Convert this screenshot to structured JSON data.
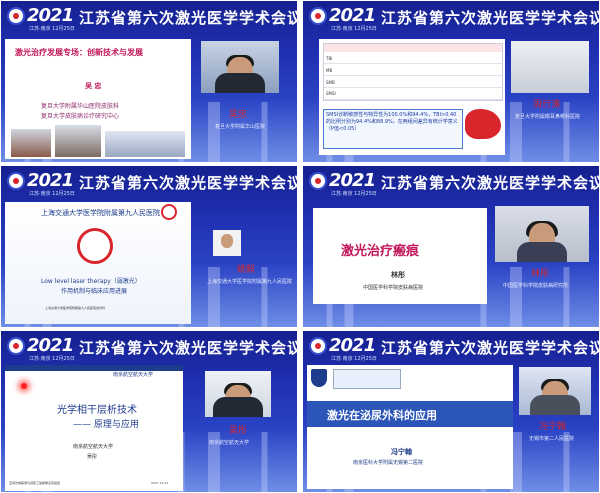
{
  "conference": {
    "year": "2021",
    "title": "江苏省第六次激光医学学术会议",
    "subtitle": "江苏·南京 12月25日"
  },
  "tiles": [
    {
      "slide_title": "激光治疗发展专场：创新技术与发展",
      "author": "吴 忠",
      "affiliations": [
        "复旦大学附属华山医院皮肤科",
        "复旦大学皮肤病诊疗研究中心"
      ],
      "speaker": "吴忠",
      "speaker_aff": "复旦大学附属华山医院"
    },
    {
      "table_rows": [
        "TBI",
        "MB",
        "SMB",
        "SMSI"
      ],
      "finding": "SMSI诊断敏感性与特异性为100.0%和94.4%，TBI>0.40的比例分别为94.4%和88.9%，在两组间差异有统计学意义（P值<0.05）",
      "speaker": "周行涛",
      "speaker_aff": "复旦大学附属眼耳鼻喉科医院"
    },
    {
      "slide_header": "上海交通大学医学院附属第九人民医院",
      "topic_en": "Low level laser therapy（弱激光）",
      "topic_cn": "作用机制与临床应用进展",
      "footer": "上海交通大学医学院附属第九人民医院激光科",
      "speaker": "姚毅",
      "speaker_aff": "上海交通大学医学院附属第九人民医院"
    },
    {
      "slide_title": "激光治疗瘢痕",
      "author": "林彤",
      "org": "中国医学科学院皮肤病医院",
      "speaker": "林彤",
      "speaker_aff": "中国医学科学院皮肤病研究所"
    },
    {
      "slide_header": "南京航空航天大学",
      "slide_title": "光学相干层析技术",
      "slide_sub": "—— 原理与应用",
      "org": "南京航空航天大学",
      "author": "吴彤",
      "footer": "空间光电探测与感知工信部重点实验室",
      "date": "2021.12.25",
      "speaker": "吴彤",
      "speaker_aff": "南京航空航天大学"
    },
    {
      "slide_title": "激光在泌尿外科的应用",
      "author": "冯宁翰",
      "org": "南京医科大学附属无锡第二医院",
      "speaker": "冯宁翰",
      "speaker_aff": "无锡市第二人民医院"
    }
  ]
}
